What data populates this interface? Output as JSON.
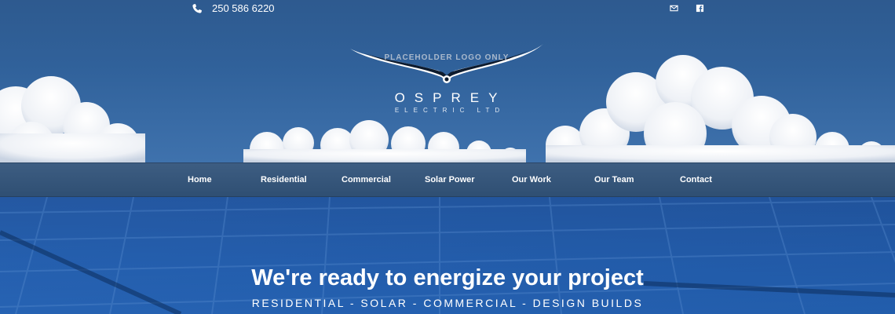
{
  "topbar": {
    "phone": "250 586 6220",
    "icons": [
      "phone-icon",
      "mail-icon",
      "facebook-icon"
    ]
  },
  "logo": {
    "placeholder": "PLACEHOLDER LOGO ONLY",
    "name": "OSPREY",
    "subtitle": "ELECTRIC LTD"
  },
  "nav": {
    "items": [
      "Home",
      "Residential",
      "Commercial",
      "Solar Power",
      "Our Work",
      "Our Team",
      "Contact"
    ]
  },
  "hero": {
    "title": "We're ready to energize your project",
    "subtitle": "RESIDENTIAL - SOLAR - COMMERCIAL - DESIGN BUILDS"
  },
  "colors": {
    "sky": "#30619a",
    "nav": "#34557a",
    "hero": "#2460b0",
    "text": "#ffffff"
  }
}
